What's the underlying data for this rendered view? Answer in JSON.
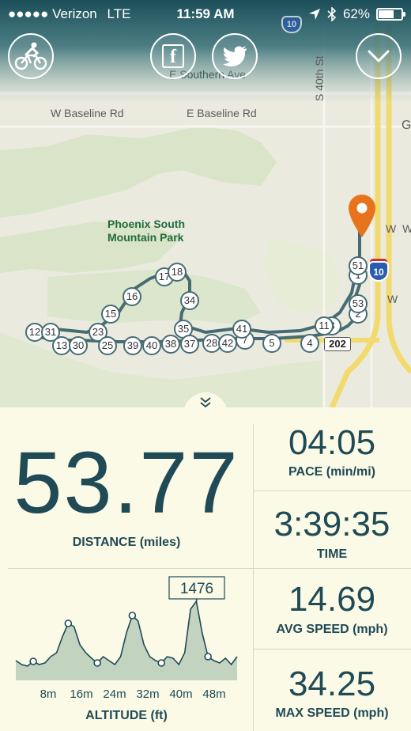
{
  "status_bar": {
    "carrier": "●●●●● Verizon",
    "network": "LTE",
    "time": "11:59 AM",
    "battery": "62%",
    "battery_fraction": 0.62
  },
  "share": {
    "facebook_glyph": "f"
  },
  "map": {
    "labels": {
      "baseline_w": "W Baseline Rd",
      "baseline_e": "E Baseline Rd",
      "southern": "E Southern Ave",
      "s40th": "S 40th St",
      "park": "Phoenix South Mountain Park",
      "g": "G",
      "ww": "W W",
      "ww2": "W",
      "shield_202": "202",
      "shield_10": "10",
      "shield_10_top": "10"
    },
    "route_markers": [
      "1",
      "2",
      "3",
      "4",
      "5",
      "7",
      "11",
      "12",
      "13",
      "15",
      "16",
      "17",
      "18",
      "23",
      "25",
      "28",
      "30",
      "31",
      "34",
      "35",
      "37",
      "38",
      "39",
      "40",
      "41",
      "42",
      "51",
      "53"
    ]
  },
  "stats": {
    "distance": {
      "value": "53.77",
      "label": "DISTANCE (miles)"
    },
    "pace": {
      "value": "04:05",
      "label": "PACE (min/mi)"
    },
    "time": {
      "value": "3:39:35",
      "label": "TIME"
    },
    "avg_speed": {
      "value": "14.69",
      "label": "AVG SPEED (mph)"
    },
    "max_speed": {
      "value": "34.25",
      "label": "MAX SPEED (mph)"
    }
  },
  "chart_data": {
    "type": "area",
    "title": "ALTITUDE (ft)",
    "x_ticks": [
      "8m",
      "16m",
      "24m",
      "32m",
      "40m",
      "48m"
    ],
    "callout": "1476",
    "colors": {
      "line": "#1f4a56",
      "fill": "#c2d4c0",
      "route": "#466b73",
      "pin": "#e8731c"
    }
  }
}
